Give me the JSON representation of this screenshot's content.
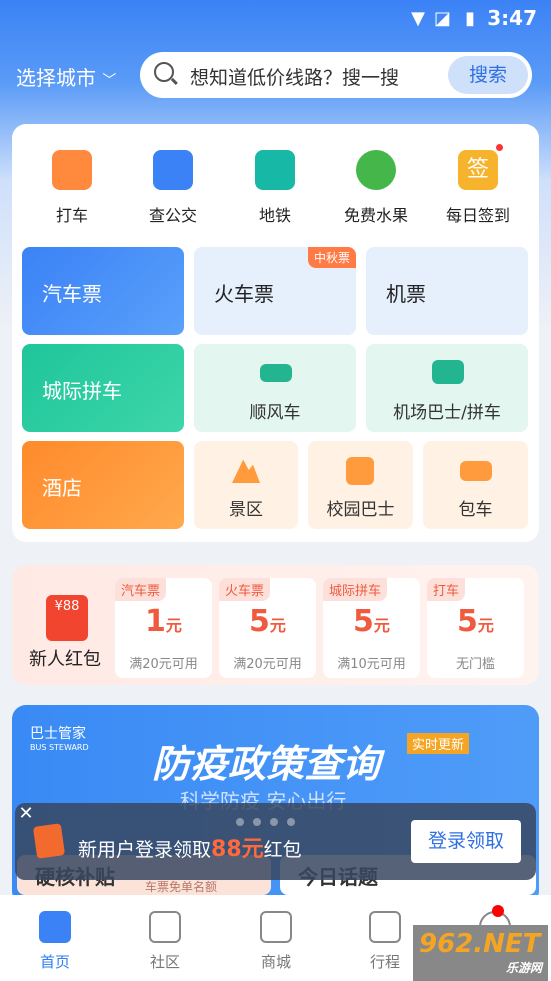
{
  "status_bar": {
    "time": "3:47"
  },
  "header": {
    "city_label": "选择城市",
    "search_placeholder": "想知道低价线路？搜一搜",
    "search_button": "搜索"
  },
  "quick_actions": [
    {
      "label": "打车",
      "icon": "taxi-icon"
    },
    {
      "label": "查公交",
      "icon": "bus-icon"
    },
    {
      "label": "地铁",
      "icon": "metro-icon"
    },
    {
      "label": "免费水果",
      "icon": "tree-icon"
    },
    {
      "label": "每日签到",
      "icon": "signin-icon",
      "icon_text": "签"
    }
  ],
  "tiles": {
    "bus_ticket": "汽车票",
    "train_ticket": "火车票",
    "train_badge": "中秋票",
    "flight": "机票",
    "intercity": "城际拼车",
    "ride_share": "顺风车",
    "airport_bus": "机场巴士/拼车",
    "hotel": "酒店",
    "scenic": "景区",
    "campus_bus": "校园巴士",
    "charter": "包车"
  },
  "red_packet": {
    "title": "新人红包",
    "envelope_text": "¥88",
    "coupons": [
      {
        "tag": "汽车票",
        "amount": "1",
        "unit": "元",
        "cond": "满20元可用"
      },
      {
        "tag": "火车票",
        "amount": "5",
        "unit": "元",
        "cond": "满20元可用"
      },
      {
        "tag": "城际拼车",
        "amount": "5",
        "unit": "元",
        "cond": "满10元可用"
      },
      {
        "tag": "打车",
        "amount": "5",
        "unit": "元",
        "cond": "无门槛"
      }
    ]
  },
  "banner": {
    "brand": "巴士管家",
    "brand_en": "BUS STEWARD",
    "headline": "防疫政策查询",
    "tag": "实时更新",
    "subline": "科学防疫 安心出行"
  },
  "sections": {
    "left": "硬核补贴",
    "left_sub": "车票免单名额",
    "right": "今日话题"
  },
  "login_prompt": {
    "text_before": "新用户登录领取",
    "highlight": "88元",
    "text_after": "红包",
    "button": "登录领取"
  },
  "tabs": [
    {
      "label": "首页",
      "active": true
    },
    {
      "label": "社区"
    },
    {
      "label": "商城"
    },
    {
      "label": "行程"
    }
  ],
  "watermark": {
    "brand": "962.NET",
    "sub": "乐游网"
  },
  "colors": {
    "primary": "#3b82f6",
    "accent": "#f05a3f"
  }
}
